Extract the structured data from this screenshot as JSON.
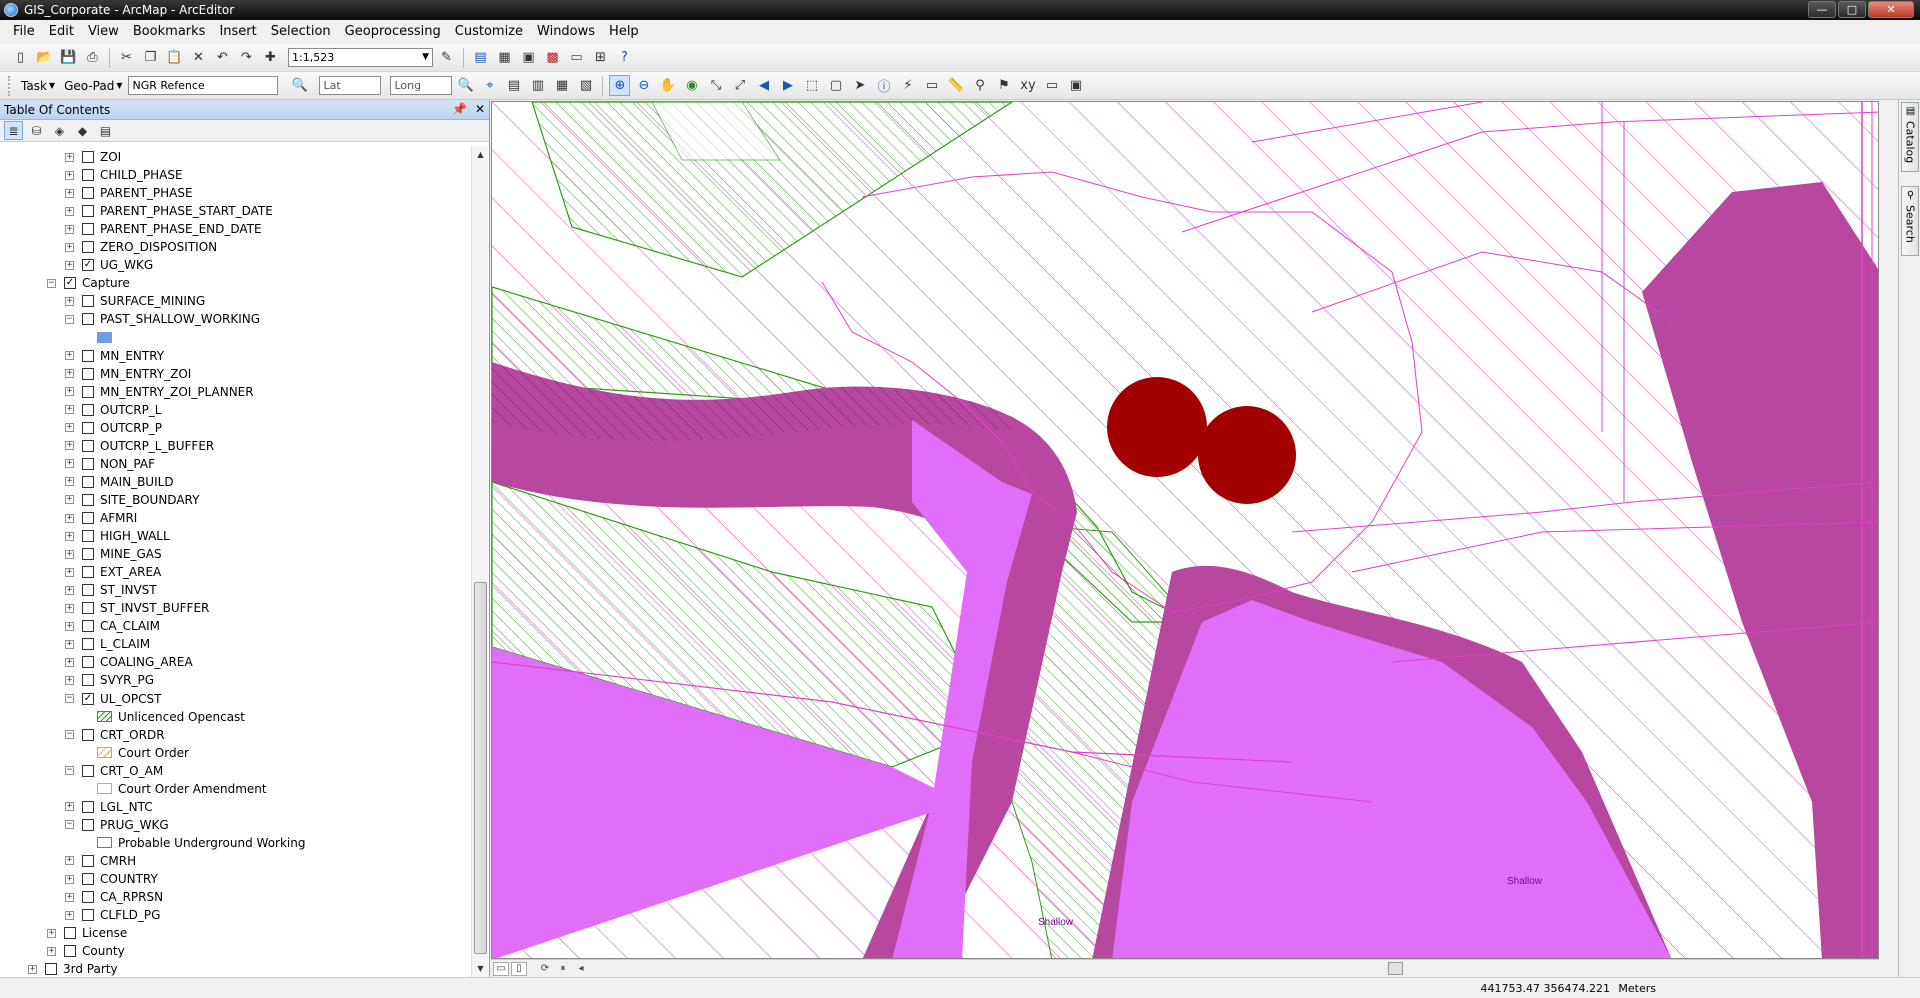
{
  "window": {
    "title": "GIS_Corporate - ArcMap - ArcEditor",
    "controls": [
      "—",
      "□",
      "✕"
    ]
  },
  "menu": [
    "File",
    "Edit",
    "View",
    "Bookmarks",
    "Insert",
    "Selection",
    "Geoprocessing",
    "Customize",
    "Windows",
    "Help"
  ],
  "toolbar": {
    "scale": "1:1,523",
    "task_label": "Task",
    "geopad_label": "Geo-Pad",
    "ngr_field": "NGR Refence",
    "lat_field": "Lat",
    "long_field": "Long"
  },
  "toc": {
    "title": "Table Of Contents",
    "pin": "📌",
    "close": "✕",
    "items": [
      {
        "label": "ZOI",
        "indent": 1,
        "exp": "+",
        "checked": false
      },
      {
        "label": "CHILD_PHASE",
        "indent": 1,
        "exp": "+",
        "checked": false
      },
      {
        "label": "PARENT_PHASE",
        "indent": 1,
        "exp": "+",
        "checked": false
      },
      {
        "label": "PARENT_PHASE_START_DATE",
        "indent": 1,
        "exp": "+",
        "checked": false
      },
      {
        "label": "PARENT_PHASE_END_DATE",
        "indent": 1,
        "exp": "+",
        "checked": false
      },
      {
        "label": "ZERO_DISPOSITION",
        "indent": 1,
        "exp": "+",
        "checked": false
      },
      {
        "label": "UG_WKG",
        "indent": 1,
        "exp": "+",
        "checked": true
      },
      {
        "label": "Capture",
        "indent": 0,
        "exp": "−",
        "checked": true
      },
      {
        "label": "SURFACE_MINING",
        "indent": 1,
        "exp": "+",
        "checked": false
      },
      {
        "label": "PAST_SHALLOW_WORKING",
        "indent": 1,
        "exp": "−",
        "checked": false
      },
      {
        "label": "",
        "indent": 2,
        "symbol": "blue-fill"
      },
      {
        "label": "MN_ENTRY",
        "indent": 1,
        "exp": "+",
        "checked": false
      },
      {
        "label": "MN_ENTRY_ZOI",
        "indent": 1,
        "exp": "+",
        "checked": false
      },
      {
        "label": "MN_ENTRY_ZOI_PLANNER",
        "indent": 1,
        "exp": "+",
        "checked": false
      },
      {
        "label": "OUTCRP_L",
        "indent": 1,
        "exp": "+",
        "checked": false
      },
      {
        "label": "OUTCRP_P",
        "indent": 1,
        "exp": "+",
        "checked": false
      },
      {
        "label": "OUTCRP_L_BUFFER",
        "indent": 1,
        "exp": "+",
        "checked": false
      },
      {
        "label": "NON_PAF",
        "indent": 1,
        "exp": "+",
        "checked": false
      },
      {
        "label": "MAIN_BUILD",
        "indent": 1,
        "exp": "+",
        "checked": false
      },
      {
        "label": "SITE_BOUNDARY",
        "indent": 1,
        "exp": "+",
        "checked": false
      },
      {
        "label": "AFMRI",
        "indent": 1,
        "exp": "+",
        "checked": false
      },
      {
        "label": "HIGH_WALL",
        "indent": 1,
        "exp": "+",
        "checked": false
      },
      {
        "label": "MINE_GAS",
        "indent": 1,
        "exp": "+",
        "checked": false
      },
      {
        "label": "EXT_AREA",
        "indent": 1,
        "exp": "+",
        "checked": false
      },
      {
        "label": "ST_INVST",
        "indent": 1,
        "exp": "+",
        "checked": false
      },
      {
        "label": "ST_INVST_BUFFER",
        "indent": 1,
        "exp": "+",
        "checked": false
      },
      {
        "label": "CA_CLAIM",
        "indent": 1,
        "exp": "+",
        "checked": false
      },
      {
        "label": "L_CLAIM",
        "indent": 1,
        "exp": "+",
        "checked": false
      },
      {
        "label": "COALING_AREA",
        "indent": 1,
        "exp": "+",
        "checked": false
      },
      {
        "label": "SVYR_PG",
        "indent": 1,
        "exp": "+",
        "checked": false
      },
      {
        "label": "UL_OPCST",
        "indent": 1,
        "exp": "−",
        "checked": true
      },
      {
        "label": "Unlicenced Opencast",
        "indent": 2,
        "symbol": "green-hatch"
      },
      {
        "label": "CRT_ORDR",
        "indent": 1,
        "exp": "−",
        "checked": false
      },
      {
        "label": "Court Order",
        "indent": 2,
        "symbol": "orange-hatch"
      },
      {
        "label": "CRT_O_AM",
        "indent": 1,
        "exp": "−",
        "checked": false
      },
      {
        "label": "Court Order Amendment",
        "indent": 2,
        "symbol": "orange-outline"
      },
      {
        "label": "LGL_NTC",
        "indent": 1,
        "exp": "+",
        "checked": false
      },
      {
        "label": "PRUG_WKG",
        "indent": 1,
        "exp": "−",
        "checked": false
      },
      {
        "label": "Probable Underground Working",
        "indent": 2,
        "symbol": "purple-outline"
      },
      {
        "label": "CMRH",
        "indent": 1,
        "exp": "+",
        "checked": false
      },
      {
        "label": "COUNTRY",
        "indent": 1,
        "exp": "+",
        "checked": false
      },
      {
        "label": "CA_RPRSN",
        "indent": 1,
        "exp": "+",
        "checked": false
      },
      {
        "label": "CLFLD_PG",
        "indent": 1,
        "exp": "+",
        "checked": false
      },
      {
        "label": "License",
        "indent": 0,
        "exp": "+",
        "checked": false
      },
      {
        "label": "County",
        "indent": 0,
        "exp": "+",
        "checked": false
      },
      {
        "label": "3rd Party",
        "indent": -1,
        "exp": "+",
        "checked": false
      }
    ]
  },
  "map": {
    "labels": [
      "Shallow",
      "Shallow"
    ],
    "colors": {
      "purple_fill": "#e06ef8",
      "dark_buffer": "#b7479f",
      "pink_line": "#e040c8",
      "green_line": "#2e9b16",
      "red_point": "#a20000"
    }
  },
  "side_tabs": [
    "Catalog",
    "Search"
  ],
  "status": {
    "coords": "441753.47  356474.221",
    "units": "Meters"
  }
}
